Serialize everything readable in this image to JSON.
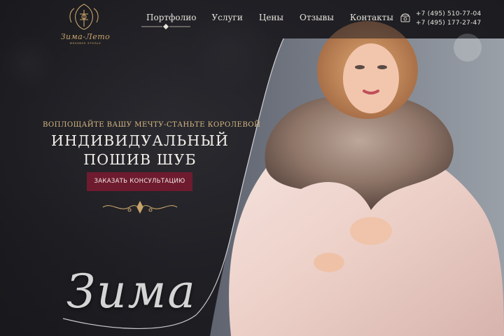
{
  "logo": {
    "script": "Зима-Лето",
    "subtitle": "меховое ателье"
  },
  "nav": {
    "items": [
      {
        "label": "Портфолио",
        "active": true
      },
      {
        "label": "Услуги"
      },
      {
        "label": "Цены"
      },
      {
        "label": "Отзывы"
      },
      {
        "label": "Контакты"
      }
    ]
  },
  "contacts": {
    "phone1": "+7 (495) 510-77-04",
    "phone2": "+7 (495) 177-27-47"
  },
  "hero": {
    "tagline": "ВОПЛОЩАЙТЕ ВАШУ МЕЧТУ-СТАНЬТЕ КОРОЛЕВОЙ",
    "headline_line1": "ИНДИВИДУАЛЬНЫЙ",
    "headline_line2": "ПОШИВ ШУБ",
    "cta_label": "ЗАКАЗАТЬ КОНСУЛЬТАЦИЮ",
    "watermark": "Зима"
  },
  "colors": {
    "accent": "#6e1b2f",
    "gold": "#c9a46a",
    "text": "#f2eee8"
  }
}
